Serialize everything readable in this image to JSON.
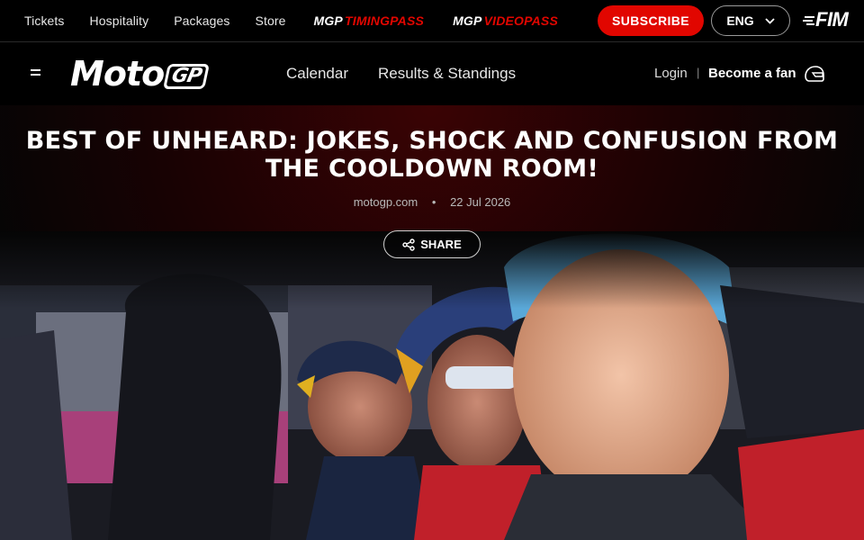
{
  "topbar": {
    "links": [
      "Tickets",
      "Hospitality",
      "Packages",
      "Store"
    ],
    "passes": [
      {
        "brand": "MGP",
        "name": "TIMINGPASS"
      },
      {
        "brand": "MGP",
        "name": "VIDEOPASS"
      }
    ],
    "subscribe_label": "SUBSCRIBE",
    "language": "ENG",
    "fim_logo_text": "FIM"
  },
  "nav": {
    "logo_text": "Moto",
    "logo_gp": "GP",
    "links": [
      "Calendar",
      "Results & Standings"
    ],
    "login_label": "Login",
    "separator": "|",
    "become_fan_label": "Become a fan"
  },
  "article": {
    "title": "BEST OF UNHEARD: JOKES, SHOCK AND CONFUSION FROM THE COOLDOWN ROOM!",
    "source": "motogp.com",
    "dot": "•",
    "date": "22 Jul 2026",
    "share_label": "SHARE"
  },
  "colors": {
    "brand_red": "#e10600",
    "background": "#000000"
  }
}
